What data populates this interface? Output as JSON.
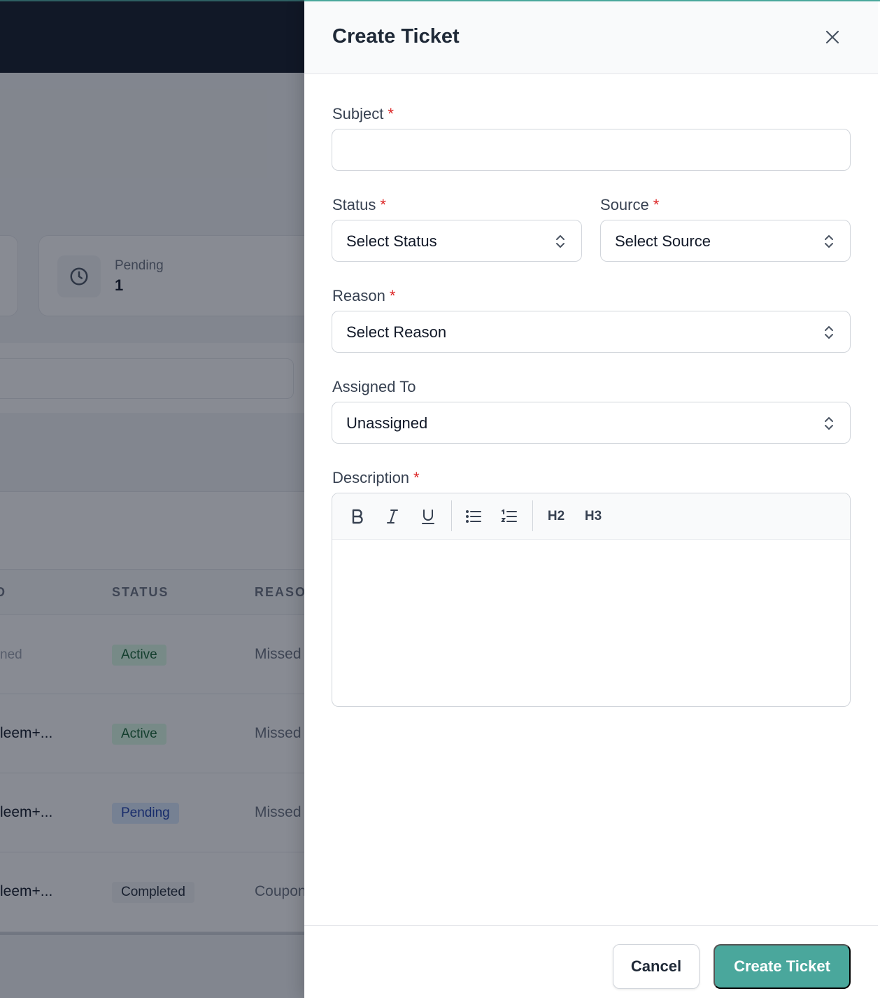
{
  "background": {
    "stat_card": {
      "label": "Pending",
      "value": "1"
    },
    "table": {
      "headers": {
        "assigned": "D",
        "status": "STATUS",
        "reason": "REASO"
      },
      "rows": [
        {
          "assigned": "ned",
          "status": "Active",
          "reason": "Missed"
        },
        {
          "assigned": "leem+...",
          "status": "Active",
          "reason": "Missed"
        },
        {
          "assigned": "leem+...",
          "status": "Pending",
          "reason": "Missed"
        },
        {
          "assigned": "leem+...",
          "status": "Completed",
          "reason": "Coupon"
        }
      ]
    }
  },
  "drawer": {
    "title": "Create Ticket",
    "close_icon": "close-icon",
    "fields": {
      "subject": {
        "label": "Subject",
        "required": "*",
        "value": "",
        "placeholder": ""
      },
      "status": {
        "label": "Status",
        "required": "*",
        "value": "Select Status"
      },
      "source": {
        "label": "Source",
        "required": "*",
        "value": "Select Source"
      },
      "reason": {
        "label": "Reason",
        "required": "*",
        "value": "Select Reason"
      },
      "assigned_to": {
        "label": "Assigned To",
        "value": "Unassigned"
      },
      "description": {
        "label": "Description",
        "required": "*"
      }
    },
    "toolbar": {
      "bold_icon": "bold-icon",
      "italic_icon": "italic-icon",
      "underline_icon": "underline-icon",
      "bullet_list_icon": "bullet-list-icon",
      "ordered_list_icon": "ordered-list-icon",
      "h2": "H2",
      "h3": "H3"
    },
    "footer": {
      "cancel": "Cancel",
      "submit": "Create Ticket"
    }
  },
  "colors": {
    "accent": "#4aa79c",
    "required": "#dc2626",
    "topbar": "#111827"
  }
}
